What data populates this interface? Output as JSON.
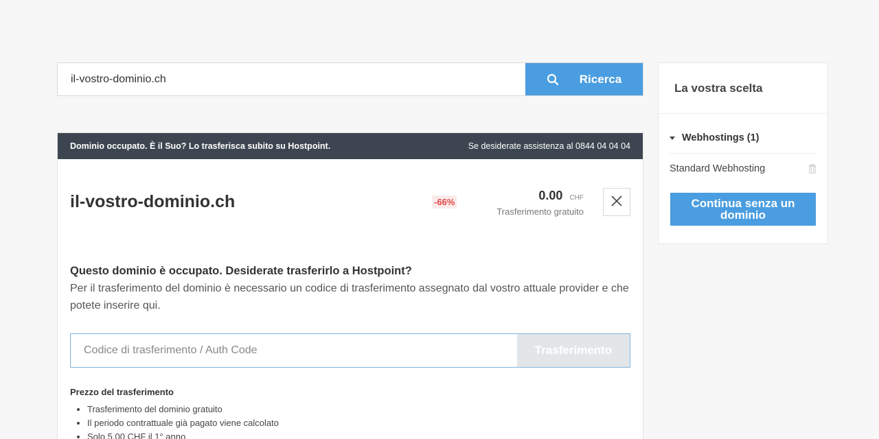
{
  "search": {
    "value": "il-vostro-dominio.ch",
    "button_label": "Ricerca",
    "icon": "search-icon"
  },
  "notice": {
    "left": "Dominio occupato. È il Suo? Lo trasferisca subito su Hostpoint.",
    "right": "Se desiderate assistenza al 0844 04 04 04"
  },
  "domain": {
    "name": "il-vostro-dominio.ch",
    "discount": "-66%",
    "price": "0.00",
    "currency": "CHF",
    "price_note": "Trasferimento gratuito"
  },
  "transfer": {
    "title": "Questo dominio è occupato. Desiderate trasferirlo a Hostpoint?",
    "description": "Per il trasferimento del dominio è necessario un codice di trasferimento assegnato dal vostro attuale provider e che potete inserire qui.",
    "auth_placeholder": "Codice di trasferimento / Auth Code",
    "button_label": "Trasferimento"
  },
  "price_info": {
    "title": "Prezzo del trasferimento",
    "items": [
      "Trasferimento del dominio gratuito",
      "Il periodo contrattuale già pagato viene calcolato",
      "Solo 5.00 CHF il 1° anno"
    ]
  },
  "sidebar": {
    "title": "La vostra scelta",
    "category": "Webhostings (1)",
    "item": "Standard Webhosting",
    "continue_label": "Continua senza un dominio"
  },
  "colors": {
    "accent": "#4a9de0",
    "notice_bg": "#3d4650",
    "discount": "#e34848"
  }
}
